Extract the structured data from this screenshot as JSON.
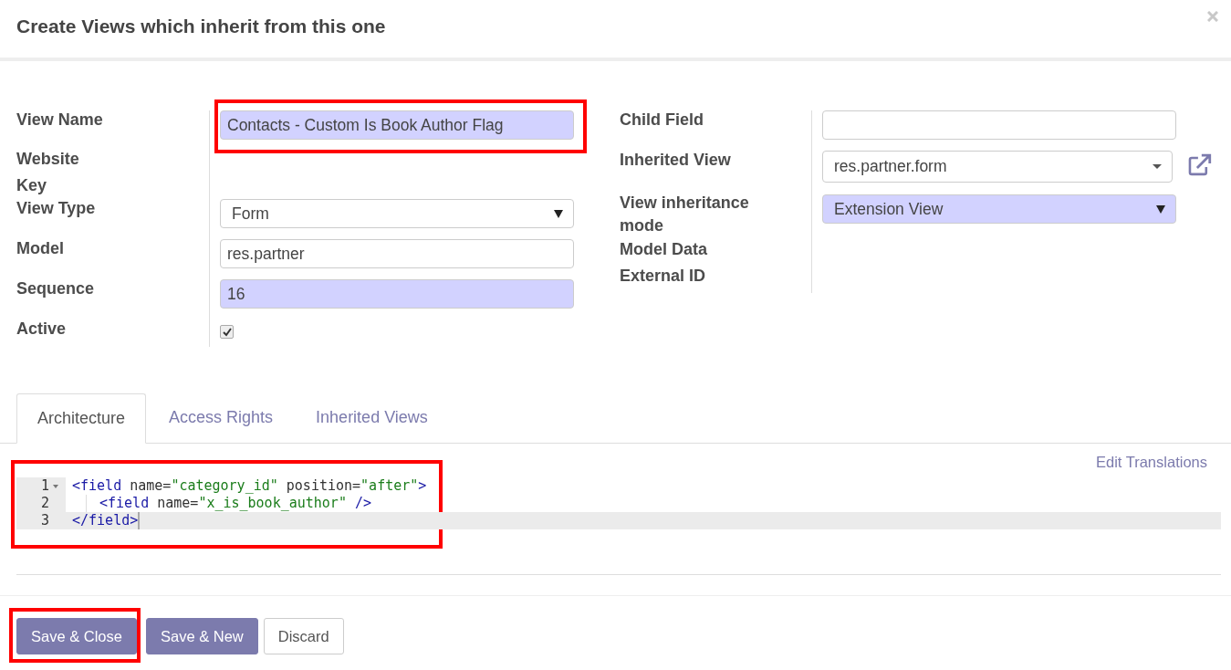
{
  "dialog": {
    "title": "Create Views which inherit from this one"
  },
  "left_fields": [
    {
      "label": "View Name",
      "kind": "text",
      "value": "Contacts - Custom Is Book Author Flag",
      "required": true,
      "highlighted": true
    },
    {
      "label": "Website Key",
      "kind": "none"
    },
    {
      "label": "View Type",
      "kind": "select",
      "value": "Form",
      "required": false,
      "highlighted": false
    },
    {
      "label": "Model",
      "kind": "text",
      "value": "res.partner",
      "required": false,
      "highlighted": false
    },
    {
      "label": "Sequence",
      "kind": "text",
      "value": "16",
      "required": true,
      "highlighted": false
    },
    {
      "label": "Active",
      "kind": "checkbox",
      "checked": true
    }
  ],
  "right_fields": [
    {
      "label": "Child Field",
      "kind": "text",
      "required": false,
      "highlighted": false
    },
    {
      "label": "Inherited View",
      "kind": "many2one",
      "value": "res.partner.form",
      "required": false,
      "highlighted": false
    },
    {
      "label": "View inheritance mode",
      "kind": "select",
      "value": "Extension View",
      "required": true,
      "highlighted": false
    },
    {
      "label": "Model Data",
      "kind": "none"
    },
    {
      "label": "External ID",
      "kind": "none"
    }
  ],
  "tabs": [
    {
      "label": "Architecture",
      "selected": true
    },
    {
      "label": "Access Rights",
      "selected": false
    },
    {
      "label": "Inherited Views",
      "selected": false
    }
  ],
  "edit_translations": "Edit Translations",
  "code_editor": {
    "highlighted": true,
    "lines": [
      {
        "number": "1",
        "foldable": true,
        "indented": false,
        "current": false,
        "tokens": [
          {
            "kind": "tag",
            "text": "<field"
          },
          {
            "kind": "attr",
            "text": " name="
          },
          {
            "kind": "string",
            "text": "\"category_id\""
          },
          {
            "kind": "attr",
            "text": " position="
          },
          {
            "kind": "string",
            "text": "\"after\""
          },
          {
            "kind": "tag",
            "text": ">"
          }
        ]
      },
      {
        "number": "2",
        "foldable": false,
        "indented": true,
        "current": false,
        "tokens": [
          {
            "kind": "tag",
            "text": "<field"
          },
          {
            "kind": "attr",
            "text": " name="
          },
          {
            "kind": "string",
            "text": "\"x_is_book_author\""
          },
          {
            "kind": "tag",
            "text": " />"
          }
        ]
      },
      {
        "number": "3",
        "foldable": false,
        "indented": false,
        "current": true,
        "tokens": [
          {
            "kind": "tag",
            "text": "</field>"
          }
        ]
      }
    ]
  },
  "buttons": [
    {
      "label": "Save & Close",
      "kind": "primary",
      "highlighted": true
    },
    {
      "label": "Save & New",
      "kind": "primary",
      "highlighted": false
    },
    {
      "label": "Discard",
      "kind": "secondary",
      "highlighted": false
    }
  ]
}
